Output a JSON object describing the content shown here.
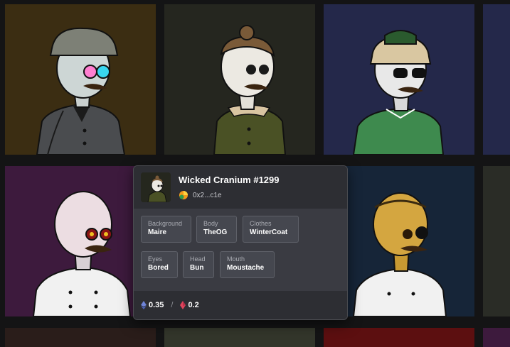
{
  "grid": {
    "tiles": [
      {
        "name": "tile-r1-c1",
        "bg": "#3b2d12"
      },
      {
        "name": "tile-r1-c2",
        "bg": "#25261f"
      },
      {
        "name": "tile-r1-c3",
        "bg": "#24284a"
      },
      {
        "name": "tile-r1-c4",
        "bg": "#24284a"
      },
      {
        "name": "tile-r2-c1",
        "bg": "#3d1a3d"
      },
      {
        "name": "tile-r2-c3",
        "bg": "#162538"
      },
      {
        "name": "tile-r2-c4",
        "bg": "#2a2c26"
      },
      {
        "name": "tile-r3-c1",
        "bg": "#2a1d1a"
      },
      {
        "name": "tile-r3-c2",
        "bg": "#33362b"
      },
      {
        "name": "tile-r3-c3",
        "bg": "#5c0f10"
      },
      {
        "name": "tile-r3-c4",
        "bg": "#3d1a3d"
      }
    ]
  },
  "popup": {
    "title": "Wicked Cranium #1299",
    "owner": "0x2...c1e",
    "traits": [
      {
        "type": "Background",
        "value": "Maire"
      },
      {
        "type": "Body",
        "value": "TheOG"
      },
      {
        "type": "Clothes",
        "value": "WinterCoat"
      },
      {
        "type": "Eyes",
        "value": "Bored"
      },
      {
        "type": "Head",
        "value": "Bun"
      },
      {
        "type": "Mouth",
        "value": "Moustache"
      }
    ],
    "price": {
      "eth_value": "0.35",
      "separator": "/",
      "other_value": "0.2",
      "eth_icon": "ethereum-icon",
      "other_icon": "red-gem-icon"
    }
  },
  "colors": {
    "popup_header": "#2d2e33",
    "popup_body": "#3a3b42",
    "trait_box": "#45474f",
    "eth_icon": "#6f84d8",
    "gem_icon": "#e0445c"
  }
}
